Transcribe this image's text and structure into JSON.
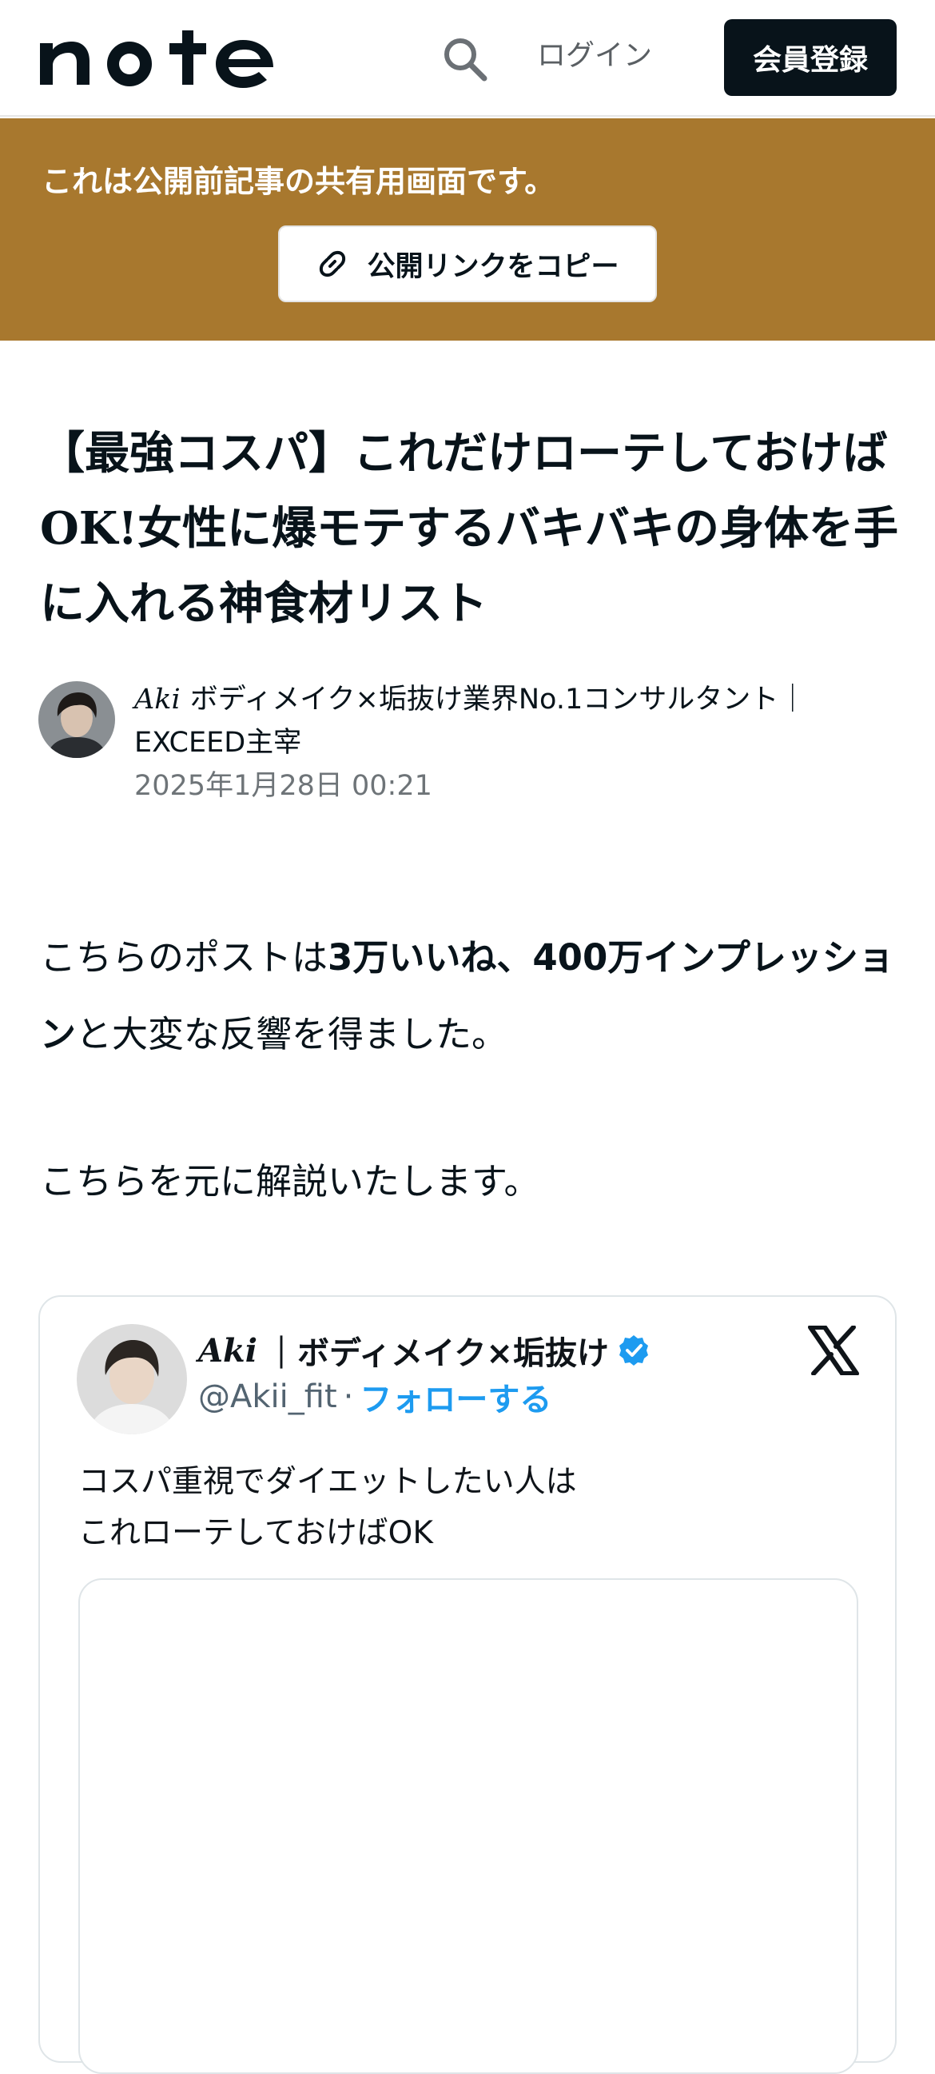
{
  "header": {
    "logo_text": "note",
    "search_icon": "search-icon",
    "login_label": "ログイン",
    "signup_label": "会員登録"
  },
  "banner": {
    "message": "これは公開前記事の共有用画面です。",
    "copy_label": "公開リンクをコピー",
    "copy_icon": "link-icon",
    "background_color": "#a8782e"
  },
  "article": {
    "title": "【最強コスパ】これだけローテしておけばOK!女性に爆モテするバキバキの身体を手に入れる神食材リスト",
    "author": {
      "name": "Aki",
      "bio": "ボディメイク×垢抜け業界No.1コンサルタント｜EXCEED主宰",
      "date": "2025年1月28日 00:21"
    },
    "paragraph1": {
      "pre": "こちらのポストは",
      "bold": "3万いいね、400万インプレッション",
      "post": "と大変な反響を得ました。"
    },
    "paragraph2": "こちらを元に解説いたします。"
  },
  "embed": {
    "name": "Aki",
    "name_rest": "｜ボディメイク×垢抜け",
    "verified_icon": "verified-badge-icon",
    "handle": "@Akii_fit",
    "separator": "·",
    "follow_label": "フォローする",
    "platform_icon": "x-logo-icon",
    "text": "コスパ重視でダイエットしたい人は\nこれローテしておけばOK",
    "accent_color": "#1d9bf0"
  }
}
